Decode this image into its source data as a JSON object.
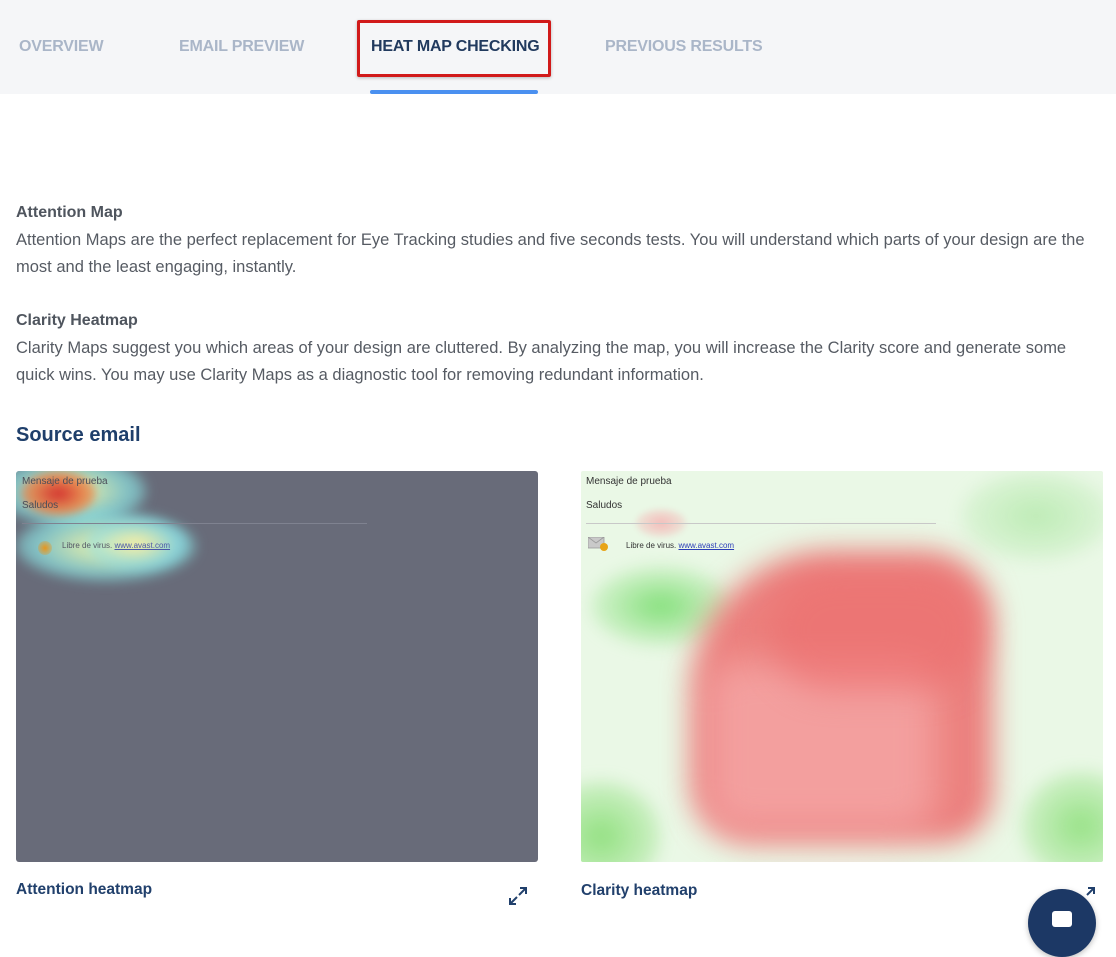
{
  "tabs": [
    {
      "label": "OVERVIEW",
      "active": false
    },
    {
      "label": "EMAIL PREVIEW",
      "active": false
    },
    {
      "label": "HEAT MAP CHECKING",
      "active": true
    },
    {
      "label": "PREVIOUS RESULTS",
      "active": false
    }
  ],
  "attention": {
    "title": "Attention Map",
    "text": "Attention Maps are the perfect replacement for Eye Tracking studies and five seconds tests. You will understand which parts of your design are the most and the least engaging, instantly."
  },
  "clarity": {
    "title": "Clarity Heatmap",
    "text": "Clarity Maps suggest you which areas of your design are cluttered. By analyzing the map, you will increase the Clarity score and generate some quick wins. You may use Clarity Maps as a diagnostic tool for removing redundant information."
  },
  "source": {
    "title": "Source email"
  },
  "email": {
    "subject": "Mensaje de prueba",
    "greeting": "Saludos",
    "virus_text": "Libre de virus.",
    "virus_link": "www.avast.com"
  },
  "heatmaps": {
    "attention_label": "Attention heatmap",
    "clarity_label": "Clarity heatmap"
  },
  "colors": {
    "accent": "#4a90f0",
    "highlight": "#d11a1a",
    "active_tab": "#213a5e",
    "inactive_tab": "#aab6c8",
    "heading": "#1f3f6b"
  },
  "icons": [
    "expand-icon",
    "envelope-icon",
    "chat-icon"
  ]
}
